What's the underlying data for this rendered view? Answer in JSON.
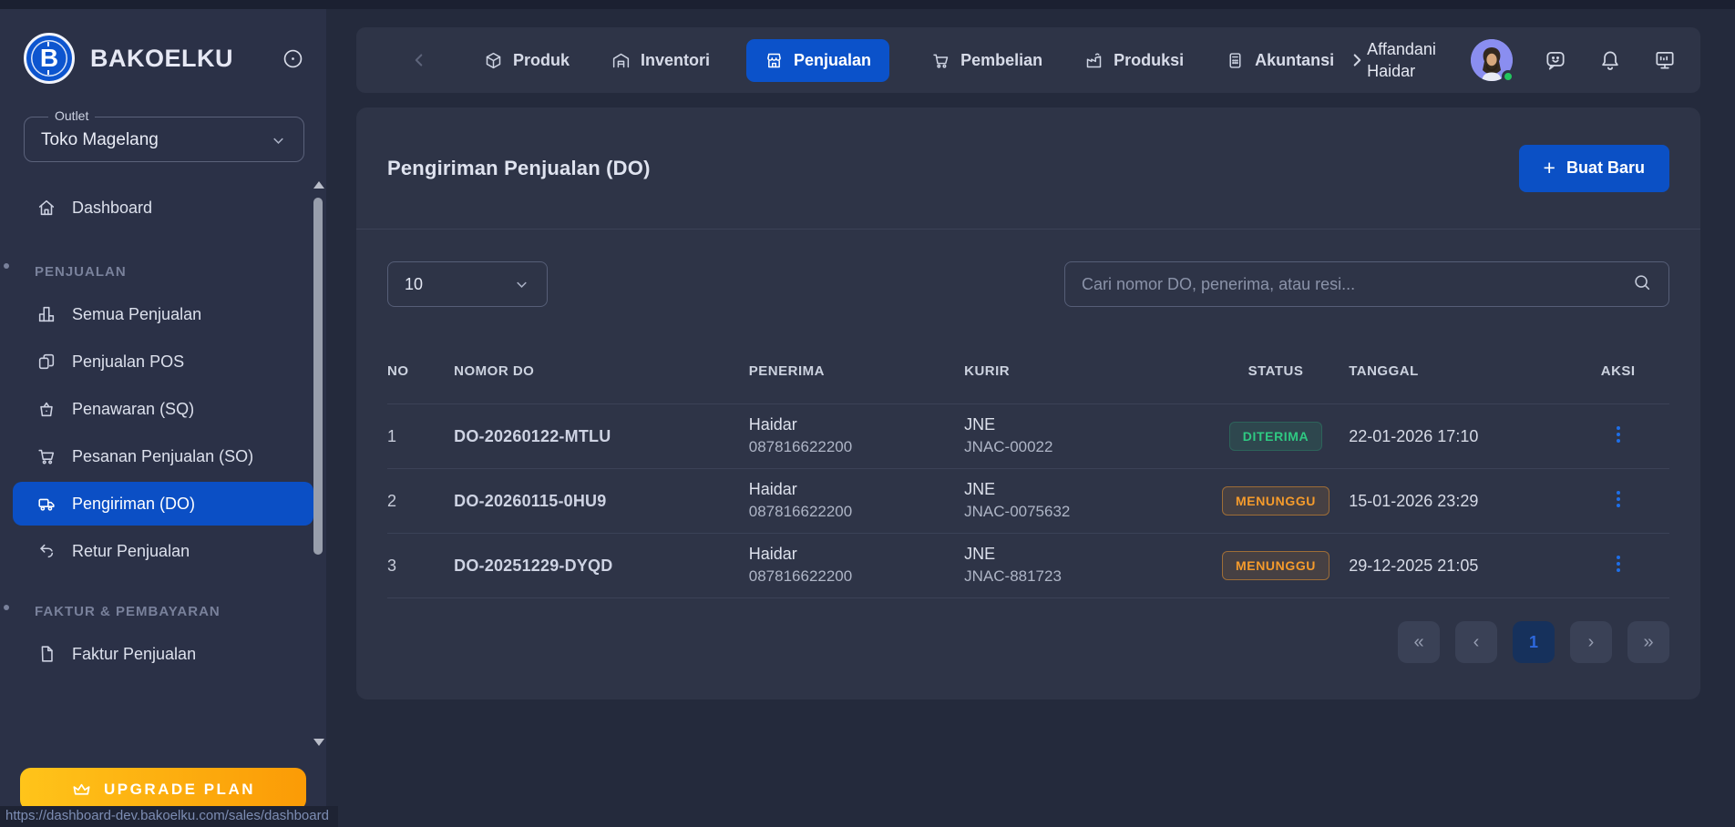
{
  "brand": {
    "name": "BAKOELKU"
  },
  "outlet": {
    "label": "Outlet",
    "value": "Toko Magelang"
  },
  "sidebar": {
    "dashboard": {
      "label": "Dashboard",
      "icon": "home-icon"
    },
    "sections": [
      {
        "label": "PENJUALAN",
        "items": [
          {
            "label": "Semua Penjualan",
            "icon": "bar-chart-icon",
            "active": false
          },
          {
            "label": "Penjualan POS",
            "icon": "pos-copy-icon",
            "active": false
          },
          {
            "label": "Penawaran (SQ)",
            "icon": "basket-icon",
            "active": false
          },
          {
            "label": "Pesanan Penjualan (SO)",
            "icon": "cart-icon",
            "active": false
          },
          {
            "label": "Pengiriman (DO)",
            "icon": "truck-icon",
            "active": true
          },
          {
            "label": "Retur Penjualan",
            "icon": "return-icon",
            "active": false
          }
        ]
      },
      {
        "label": "FAKTUR & PEMBAYARAN",
        "items": [
          {
            "label": "Faktur Penjualan",
            "icon": "document-icon",
            "active": false
          }
        ]
      }
    ],
    "upgrade_label": "UPGRADE PLAN"
  },
  "topnav": {
    "items": [
      {
        "label": "Produk",
        "icon": "box-icon",
        "active": false
      },
      {
        "label": "Inventori",
        "icon": "warehouse-icon",
        "active": false
      },
      {
        "label": "Penjualan",
        "icon": "store-icon",
        "active": true
      },
      {
        "label": "Pembelian",
        "icon": "cart-icon",
        "active": false
      },
      {
        "label": "Produksi",
        "icon": "factory-icon",
        "active": false
      },
      {
        "label": "Akuntansi",
        "icon": "calculator-icon",
        "active": false
      }
    ],
    "user_name": "Affandani Haidar"
  },
  "page": {
    "title": "Pengiriman Penjualan (DO)",
    "create_plus": "+",
    "create_label": "Buat Baru"
  },
  "controls": {
    "page_size": "10",
    "search_placeholder": "Cari nomor DO, penerima, atau resi..."
  },
  "table": {
    "headers": [
      "NO",
      "NOMOR DO",
      "PENERIMA",
      "KURIR",
      "STATUS",
      "TANGGAL",
      "AKSI"
    ],
    "rows": [
      {
        "no": "1",
        "nomor_do": "DO-20260122-MTLU",
        "penerima_nama": "Haidar",
        "penerima_telp": "087816622200",
        "kurir": "JNE",
        "resi": "JNAC-00022",
        "status": "DITERIMA",
        "status_type": "success",
        "tanggal": "22-01-2026 17:10"
      },
      {
        "no": "2",
        "nomor_do": "DO-20260115-0HU9",
        "penerima_nama": "Haidar",
        "penerima_telp": "087816622200",
        "kurir": "JNE",
        "resi": "JNAC-0075632",
        "status": "MENUNGGU",
        "status_type": "warning",
        "tanggal": "15-01-2026 23:29"
      },
      {
        "no": "3",
        "nomor_do": "DO-20251229-DYQD",
        "penerima_nama": "Haidar",
        "penerima_telp": "087816622200",
        "kurir": "JNE",
        "resi": "JNAC-881723",
        "status": "MENUNGGU",
        "status_type": "warning",
        "tanggal": "29-12-2025 21:05"
      }
    ]
  },
  "pagination": {
    "first": "«",
    "prev": "‹",
    "current": "1",
    "next": "›",
    "last": "»"
  },
  "statusbar": {
    "url": "https://dashboard-dev.bakoelku.com/sales/dashboard"
  },
  "colors": {
    "accent_blue": "#0b52ca",
    "status_success": "#2fc982",
    "status_warning": "#f59b2c",
    "upgrade_gradient_start": "#ffc41a",
    "upgrade_gradient_end": "#fb9b06",
    "online_green": "#22c55e"
  }
}
